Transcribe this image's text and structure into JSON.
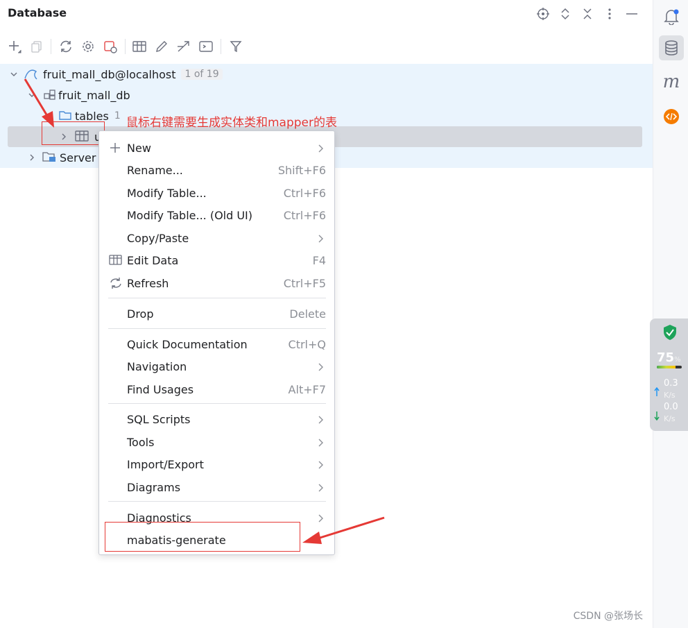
{
  "header": {
    "title": "Database"
  },
  "tree": {
    "connection": {
      "label": "fruit_mall_db@localhost",
      "counter": "1 of 19"
    },
    "schema": {
      "label": "fruit_mall_db"
    },
    "tables": {
      "label": "tables",
      "count": "1"
    },
    "table_row": {
      "label": "u"
    },
    "server": {
      "label": "Server"
    }
  },
  "annotation": {
    "text": "鼠标右键需要生成实体类和mapper的表"
  },
  "context_menu": {
    "new": {
      "label": "New"
    },
    "rename": {
      "label": "Rename...",
      "shortcut": "Shift+F6"
    },
    "modify_table": {
      "label": "Modify Table...",
      "shortcut": "Ctrl+F6"
    },
    "modify_table_old": {
      "label": "Modify Table... (Old UI)",
      "shortcut": "Ctrl+F6"
    },
    "copy_paste": {
      "label": "Copy/Paste"
    },
    "edit_data": {
      "label": "Edit Data",
      "shortcut": "F4"
    },
    "refresh": {
      "label": "Refresh",
      "shortcut": "Ctrl+F5"
    },
    "drop": {
      "label": "Drop",
      "shortcut": "Delete"
    },
    "quick_doc": {
      "label": "Quick Documentation",
      "shortcut": "Ctrl+Q"
    },
    "navigation": {
      "label": "Navigation"
    },
    "find_usages": {
      "label": "Find Usages",
      "shortcut": "Alt+F7"
    },
    "sql_scripts": {
      "label": "SQL Scripts"
    },
    "tools": {
      "label": "Tools"
    },
    "import_export": {
      "label": "Import/Export"
    },
    "diagrams": {
      "label": "Diagrams"
    },
    "diagnostics": {
      "label": "Diagnostics"
    },
    "mabatis_generate": {
      "label": "mabatis-generate"
    }
  },
  "rightbar": {
    "m_label": "m"
  },
  "monitor": {
    "percent": "75",
    "percent_unit": "%",
    "fill_fraction": 0.75,
    "upload": "0.3",
    "upload_unit": "K/s",
    "download": "0.0",
    "download_unit": "K/s"
  },
  "watermark": "CSDN @张场长",
  "colors": {
    "accent": "#3574f0",
    "annotation_red": "#e53935",
    "selection": "#d5d8de",
    "tree_bg": "#eaf4fd"
  }
}
